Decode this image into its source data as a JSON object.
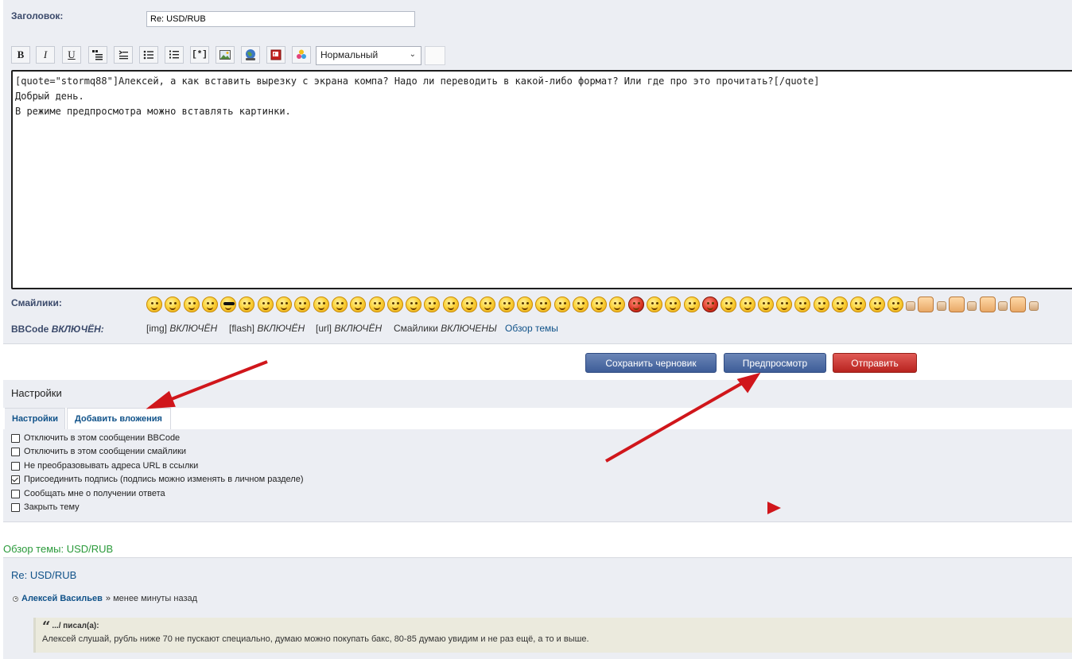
{
  "subject": {
    "label": "Заголовок:",
    "value": "Re: USD/RUB"
  },
  "toolbar": {
    "buttons": [
      {
        "name": "bold-button",
        "glyph": "B"
      },
      {
        "name": "italic-button",
        "glyph": "I"
      },
      {
        "name": "underline-button",
        "glyph": "U"
      },
      {
        "name": "quote-button",
        "icon": "quote-icon"
      },
      {
        "name": "code-button",
        "icon": "code-icon"
      },
      {
        "name": "list-button",
        "icon": "list-icon"
      },
      {
        "name": "ordered-list-button",
        "icon": "ordered-list-icon"
      },
      {
        "name": "list-item-button",
        "glyph": "[*]"
      },
      {
        "name": "image-button",
        "icon": "image-icon"
      },
      {
        "name": "url-button",
        "icon": "globe-icon"
      },
      {
        "name": "flash-button",
        "icon": "flash-icon"
      },
      {
        "name": "color-button",
        "icon": "palette-icon"
      }
    ],
    "font_size": "Нормальный"
  },
  "editor": {
    "lines": [
      "[quote=\"stormq88\"]Алексей, а как вставить вырезку с экрана компа? Надо ли переводить в какой-либо формат? Или где про это прочитать?[/quote]",
      "Добрый день.",
      "В режиме предпросмотра можно вставлять картинки."
    ]
  },
  "smilies": {
    "label": "Смайлики:",
    "count": 50
  },
  "bbcode": {
    "label_main": "BBCode",
    "label_status": "ВКЛЮЧЁН:",
    "img": "[img]",
    "img_status": "ВКЛЮЧЁН",
    "flash": "[flash]",
    "flash_status": "ВКЛЮЧЁН",
    "url": "[url]",
    "url_status": "ВКЛЮЧЁН",
    "smilies": "Смайлики",
    "smilies_status": "ВКЛЮЧЕНЫ",
    "overview_link": "Обзор темы"
  },
  "buttons": {
    "save_draft": "Сохранить черновик",
    "preview": "Предпросмотр",
    "submit": "Отправить"
  },
  "settings": {
    "title": "Настройки",
    "tabs": [
      "Настройки",
      "Добавить вложения"
    ],
    "options": [
      {
        "label": "Отключить в этом сообщении BBCode",
        "checked": false
      },
      {
        "label": "Отключить в этом сообщении смайлики",
        "checked": false
      },
      {
        "label": "Не преобразовывать адреса URL в ссылки",
        "checked": false
      },
      {
        "label": "Присоединить подпись (подпись можно изменять в личном разделе)",
        "checked": true
      },
      {
        "label": "Сообщать мне о получении ответа",
        "checked": false
      },
      {
        "label": "Закрыть тему",
        "checked": false
      }
    ]
  },
  "review": {
    "title": "Обзор темы: USD/RUB",
    "post_title": "Re: USD/RUB",
    "author": "Алексей Васильев",
    "time": "» менее минуты назад",
    "quote_author": ".../ писал(а):",
    "quote_text": "Алексей слушай, рубль ниже 70 не пускают специально, думаю можно покупать бакс, 80-85 думаю увидим и не раз ещё, а то и выше."
  },
  "colors": {
    "arrow": "#d0161b",
    "accent": "#105289",
    "panel": "#eceef3"
  }
}
